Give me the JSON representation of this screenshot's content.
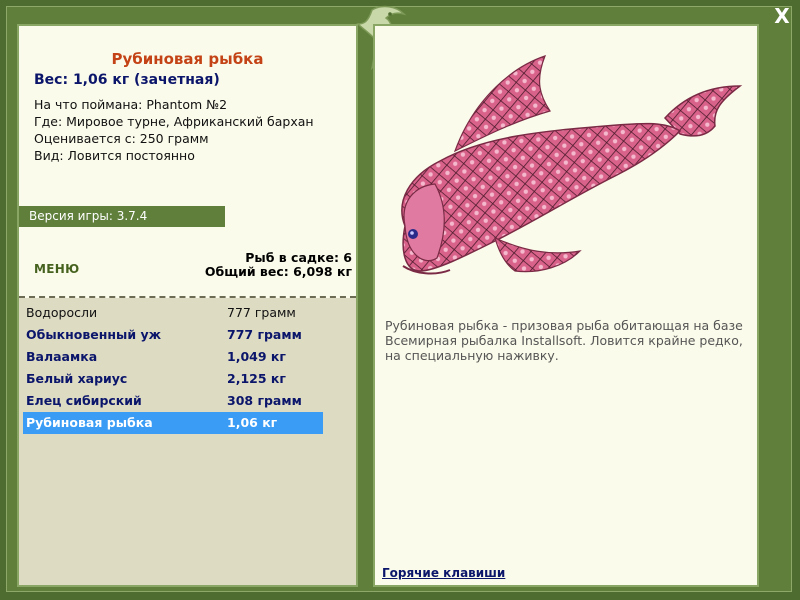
{
  "window": {
    "close_label": "X",
    "colors": {
      "frame": "#4e6c30",
      "panel": "#fbfbeb",
      "accent": "#c44316",
      "selection": "#3a9cf5"
    }
  },
  "left": {
    "fish_title": "Рубиновая рыбка",
    "weight_line": "Вес: 1,06 кг (зачетная)",
    "info": [
      "На что поймана: Phantom №2",
      "Где: Мировое турне, Африканский бархан",
      "Оценивается с: 250 грамм",
      "Вид: Ловится постоянно"
    ],
    "version_label": "Версия игры: 3.7.4",
    "menu_label": "МЕНЮ",
    "keep_count": "Рыб в садке: 6",
    "total_weight": "Общий вес: 6,098 кг"
  },
  "catch_list": [
    {
      "name": "Водоросли",
      "weight": "777 грамм",
      "style": "plain"
    },
    {
      "name": "Обыкновенный уж",
      "weight": "777 грамм",
      "style": "bold"
    },
    {
      "name": "Валаамка",
      "weight": "1,049 кг",
      "style": "bold"
    },
    {
      "name": "Белый хариус",
      "weight": "2,125 кг",
      "style": "bold"
    },
    {
      "name": "Елец сибирский",
      "weight": "308 грамм",
      "style": "bold"
    },
    {
      "name": "Рубиновая рыбка",
      "weight": "1,06 кг",
      "style": "selected"
    }
  ],
  "right": {
    "fish_image_icon": "ruby-fish-picture",
    "description": [
      "Рубиновая рыбка - призовая рыба обитающая на базе",
      "Всемирная рыбалка Installsoft. Ловится крайне редко,",
      "на специальную наживку."
    ],
    "hotkeys_label": "Горячие клавиши"
  }
}
